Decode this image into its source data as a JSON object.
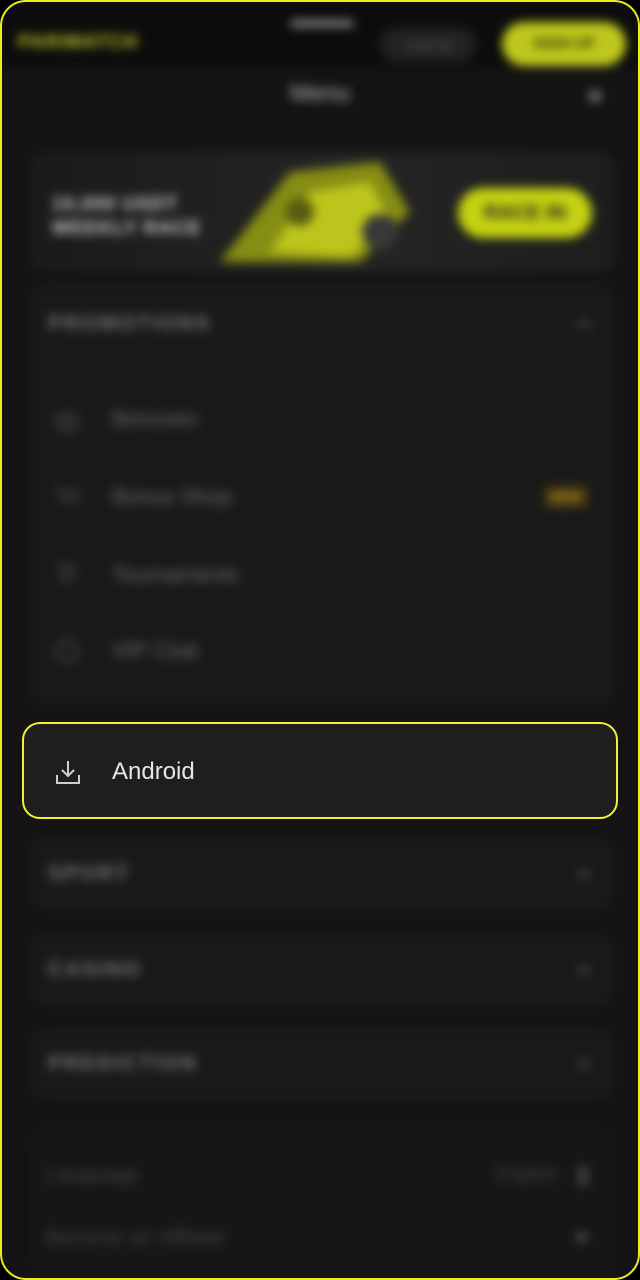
{
  "topbar": {
    "brand": "PARIMATCH",
    "login_label": "LOG IN",
    "signup_label": "SIGN UP"
  },
  "menu": {
    "title": "Menu",
    "close_icon": "close-icon"
  },
  "banner": {
    "line1": "10,000 USDT",
    "line2": "WEEKLY RACE",
    "button_label": "RACE IN"
  },
  "promotions": {
    "title": "PROMOTIONS",
    "expanded": true,
    "items": [
      {
        "label": "Bonuses",
        "icon": "gift-icon"
      },
      {
        "label": "Bonus Shop",
        "icon": "cart-icon",
        "badge": "NEW"
      },
      {
        "label": "Tournaments",
        "icon": "trophy-icon"
      },
      {
        "label": "VIP Club",
        "icon": "crown-icon"
      }
    ]
  },
  "android": {
    "label": "Android",
    "icon": "download-icon"
  },
  "sections": {
    "sport": "SPORT",
    "casino": "CASINO",
    "prediction": "PREDICTION"
  },
  "footer": {
    "language_label": "Language",
    "language_value": "English",
    "affiliate_label": "Become an Affiliate"
  },
  "colors": {
    "accent": "#e6f02a",
    "highlight_border": "#eef232",
    "background": "#141414"
  }
}
